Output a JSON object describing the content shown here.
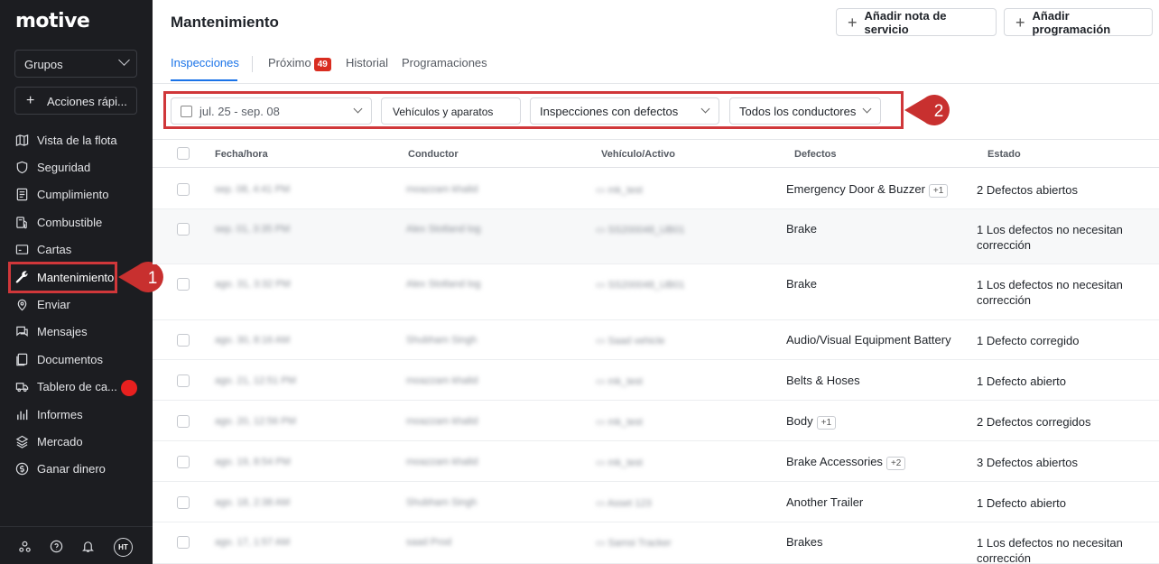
{
  "sidebar": {
    "logo": "motive",
    "groups_label": "Grupos",
    "quick_actions": "Acciones rápi...",
    "items": [
      {
        "label": "Vista de la flota",
        "icon": "map-icon"
      },
      {
        "label": "Seguridad",
        "icon": "shield-icon"
      },
      {
        "label": "Cumplimiento",
        "icon": "document-icon"
      },
      {
        "label": "Combustible",
        "icon": "fuel-icon"
      },
      {
        "label": "Cartas",
        "icon": "card-icon"
      },
      {
        "label": "Mantenimiento",
        "icon": "wrench-icon"
      },
      {
        "label": "Enviar",
        "icon": "location-icon"
      },
      {
        "label": "Mensajes",
        "icon": "messages-icon"
      },
      {
        "label": "Documentos",
        "icon": "documents-icon"
      },
      {
        "label": "Tablero de ca...",
        "icon": "truck-icon"
      },
      {
        "label": "Informes",
        "icon": "bar-chart-icon"
      },
      {
        "label": "Mercado",
        "icon": "layers-icon"
      },
      {
        "label": "Ganar dinero",
        "icon": "dollar-icon"
      }
    ],
    "avatar_initials": "HT"
  },
  "header": {
    "title": "Mantenimiento",
    "add_service_note": "Añadir nota de servicio",
    "add_schedule": "Añadir programación"
  },
  "tabs": {
    "inspections": "Inspecciones",
    "upcoming": "Próximo",
    "upcoming_count": "49",
    "history": "Historial",
    "schedules": "Programaciones"
  },
  "filters": {
    "date_range": "jul. 25 - sep. 08",
    "vehicles": "Vehículos y aparatos",
    "defects": "Inspecciones con defectos",
    "drivers": "Todos los conductores"
  },
  "callouts": {
    "one": "1",
    "two": "2"
  },
  "table": {
    "headers": [
      "Fecha/hora",
      "Conductor",
      "Vehículo/Activo",
      "Defectos",
      "Estado"
    ],
    "rows": [
      {
        "date": "sep. 08, 4:41 PM",
        "driver": "moazzam khalid",
        "vehicle": "mk_test",
        "defect": "Emergency Door & Buzzer",
        "extra": "+1",
        "status": "2 Defectos abiertos"
      },
      {
        "date": "sep. 01, 3:35 PM",
        "driver": "Alex Stotland log",
        "vehicle": "SS200048_UB01",
        "defect": "Brake",
        "extra": "",
        "status": "1 Los defectos no necesitan corrección"
      },
      {
        "date": "ago. 31, 3:32 PM",
        "driver": "Alex Stotland log",
        "vehicle": "SS200048_UB01",
        "defect": "Brake",
        "extra": "",
        "status": "1 Los defectos no necesitan corrección"
      },
      {
        "date": "ago. 30, 8:16 AM",
        "driver": "Shubham Singh",
        "vehicle": "Saad vehicle",
        "defect": "Audio/Visual Equipment Battery",
        "extra": "",
        "status": "1 Defecto corregido"
      },
      {
        "date": "ago. 21, 12:51 PM",
        "driver": "moazzam khalid",
        "vehicle": "mk_test",
        "defect": "Belts & Hoses",
        "extra": "",
        "status": "1 Defecto abierto"
      },
      {
        "date": "ago. 20, 12:56 PM",
        "driver": "moazzam khalid",
        "vehicle": "mk_test",
        "defect": "Body",
        "extra": "+1",
        "status": "2 Defectos corregidos"
      },
      {
        "date": "ago. 19, 8:54 PM",
        "driver": "moazzam khalid",
        "vehicle": "mk_test",
        "defect": "Brake Accessories",
        "extra": "+2",
        "status": "3 Defectos abiertos"
      },
      {
        "date": "ago. 18, 2:38 AM",
        "driver": "Shubham Singh",
        "vehicle": "Asset 123",
        "defect": "Another Trailer",
        "extra": "",
        "status": "1 Defecto abierto"
      },
      {
        "date": "ago. 17, 1:57 AM",
        "driver": "saad Prod",
        "vehicle": "Samsi Tracker",
        "defect": "Brakes",
        "extra": "",
        "status": "1 Los defectos no necesitan corrección"
      }
    ]
  },
  "colors": {
    "accent": "#1a73e8",
    "callout": "#d0373a",
    "sidebar": "#1c1d21",
    "badge": "#d92d20"
  }
}
